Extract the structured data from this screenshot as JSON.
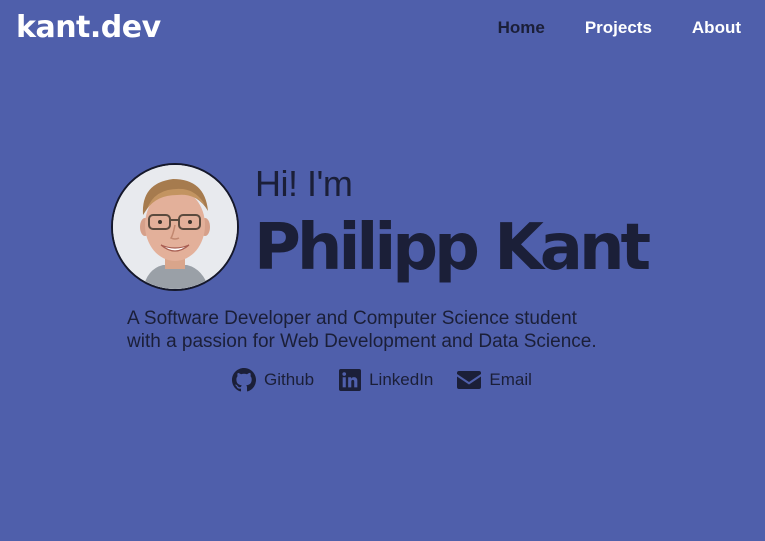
{
  "header": {
    "logo": "kant.dev",
    "nav": [
      {
        "label": "Home"
      },
      {
        "label": "Projects"
      },
      {
        "label": "About"
      }
    ]
  },
  "hero": {
    "greeting": "Hi! I'm",
    "name": "Philipp Kant",
    "bio_line1": "A Software Developer and Computer Science student",
    "bio_line2": "with a passion for Web Development and Data Science.",
    "links": {
      "github": "Github",
      "linkedin": "LinkedIn",
      "email": "Email"
    }
  },
  "icons": {
    "github": "github-icon",
    "linkedin": "linkedin-icon",
    "email": "envelope-icon"
  },
  "colors": {
    "background": "#4f5fab",
    "text_dark": "#1b1f38",
    "text_light": "#ffffff"
  }
}
